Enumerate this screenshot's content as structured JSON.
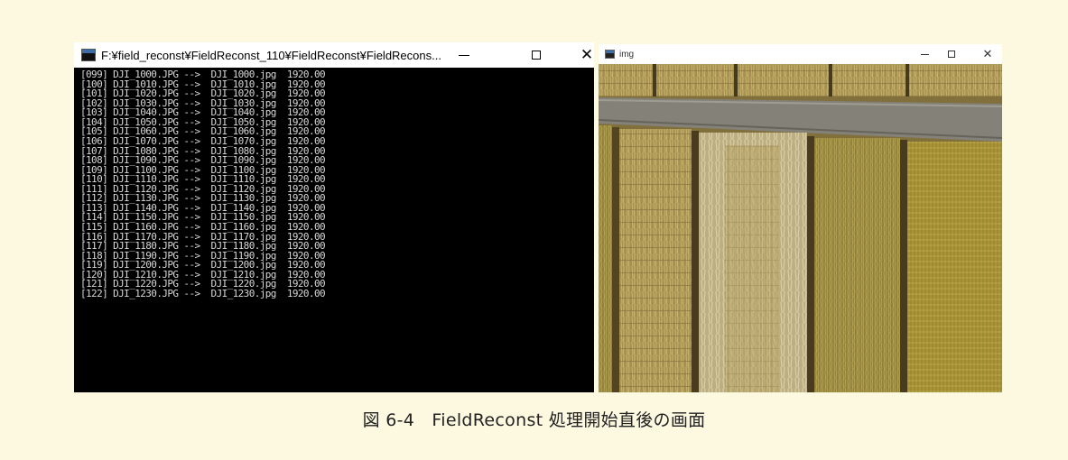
{
  "console": {
    "title": "F:¥field_reconst¥FieldReconst_110¥FieldReconst¥FieldRecons...",
    "controls": {
      "minimize": "—",
      "maximize": "☐",
      "close": "✕"
    },
    "lines": [
      "[099] DJI_1000.JPG -->  DJI_1000.jpg  1920.00",
      "[100] DJI_1010.JPG -->  DJI_1010.jpg  1920.00",
      "[101] DJI_1020.JPG -->  DJI_1020.jpg  1920.00",
      "[102] DJI_1030.JPG -->  DJI_1030.jpg  1920.00",
      "[103] DJI_1040.JPG -->  DJI_1040.jpg  1920.00",
      "[104] DJI_1050.JPG -->  DJI_1050.jpg  1920.00",
      "[105] DJI_1060.JPG -->  DJI_1060.jpg  1920.00",
      "[106] DJI_1070.JPG -->  DJI_1070.jpg  1920.00",
      "[107] DJI_1080.JPG -->  DJI_1080.jpg  1920.00",
      "[108] DJI_1090.JPG -->  DJI_1090.jpg  1920.00",
      "[109] DJI_1100.JPG -->  DJI_1100.jpg  1920.00",
      "[110] DJI_1110.JPG -->  DJI_1110.jpg  1920.00",
      "[111] DJI_1120.JPG -->  DJI_1120.jpg  1920.00",
      "[112] DJI_1130.JPG -->  DJI_1130.jpg  1920.00",
      "[113] DJI_1140.JPG -->  DJI_1140.jpg  1920.00",
      "[114] DJI_1150.JPG -->  DJI_1150.jpg  1920.00",
      "[115] DJI_1160.JPG -->  DJI_1160.jpg  1920.00",
      "[116] DJI_1170.JPG -->  DJI_1170.jpg  1920.00",
      "[117] DJI_1180.JPG -->  DJI_1180.jpg  1920.00",
      "[118] DJI_1190.JPG -->  DJI_1190.jpg  1920.00",
      "[119] DJI_1200.JPG -->  DJI_1200.jpg  1920.00",
      "[120] DJI_1210.JPG -->  DJI_1210.jpg  1920.00",
      "[121] DJI_1220.JPG -->  DJI_1220.jpg  1920.00",
      "[122] DJI_1230.JPG -->  DJI_1230.jpg  1920.00"
    ]
  },
  "image_window": {
    "title": "img",
    "controls": {
      "minimize": "—",
      "maximize": "☐",
      "close": "✕"
    }
  },
  "caption": "図 6-4　FieldReconst 処理開始直後の画面"
}
